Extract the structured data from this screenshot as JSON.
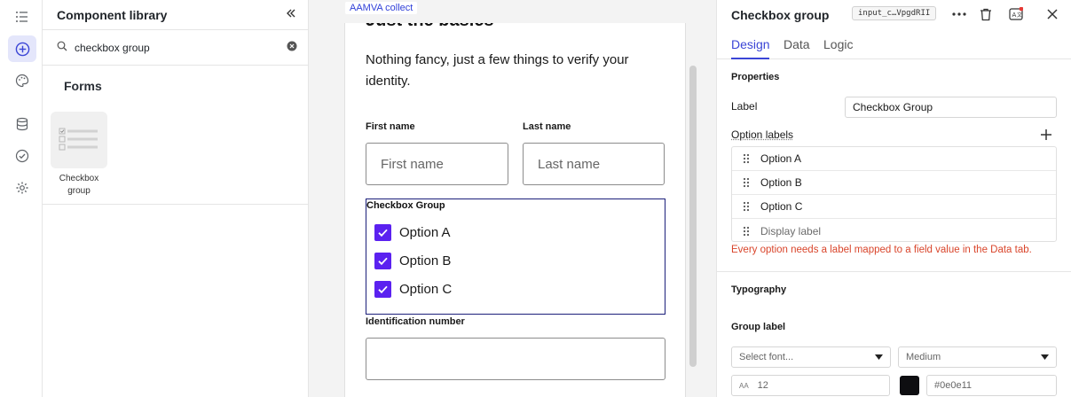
{
  "library": {
    "title": "Component library",
    "search": {
      "value": "checkbox group",
      "placeholder": ""
    },
    "section_title": "Forms",
    "tile_label": "Checkbox group"
  },
  "canvas": {
    "tag": "AAMVA collect",
    "heading": "Just the basics",
    "subtitle": "Nothing fancy, just a few things to verify your identity.",
    "first_name": {
      "label": "First name",
      "placeholder": "First name"
    },
    "last_name": {
      "label": "Last name",
      "placeholder": "Last name"
    },
    "checkbox_group": {
      "label": "Checkbox Group",
      "options": [
        "Option A",
        "Option B",
        "Option C"
      ]
    },
    "id_number": {
      "label": "Identification number"
    }
  },
  "props": {
    "title": "Checkbox group",
    "id_chip": "input_c…VpgdRII",
    "tabs": [
      "Design",
      "Data",
      "Logic"
    ],
    "properties_title": "Properties",
    "label_field": {
      "label": "Label",
      "value": "Checkbox Group"
    },
    "option_labels_title": "Option labels",
    "option_labels": [
      "Option A",
      "Option B",
      "Option C"
    ],
    "option_placeholder": "Display label",
    "error": "Every option needs a label mapped to a field value in the Data tab.",
    "typography_title": "Typography",
    "group_label_title": "Group label",
    "font_select": "Select font...",
    "weight_select": "Medium",
    "size_value": "12",
    "color_value": "#0e0e11"
  },
  "colors": {
    "accent": "#3b45d6",
    "checkbox": "#5b21f0",
    "error": "#d9452b",
    "group_text": "#0e0e11"
  }
}
